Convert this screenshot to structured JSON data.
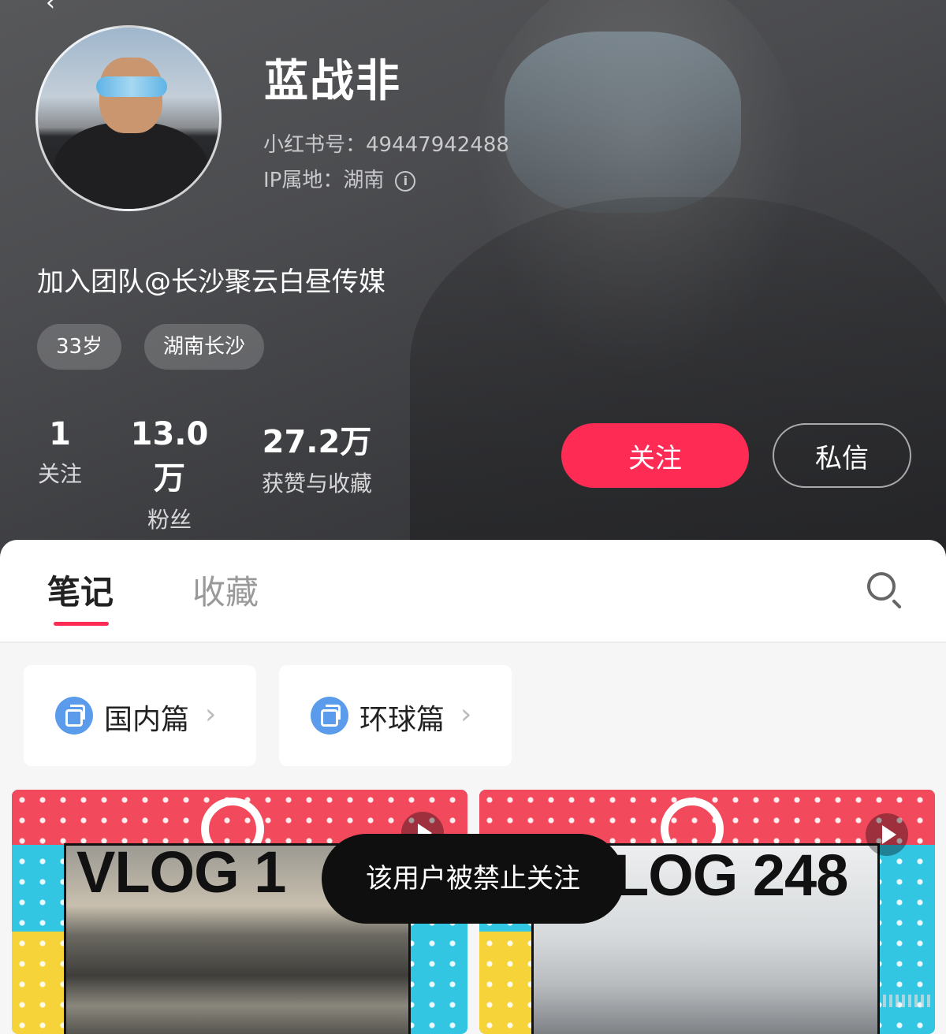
{
  "profile": {
    "name": "蓝战非",
    "account_label": "小红书号：",
    "account_id": "49447942488",
    "ip_label": "IP属地：",
    "ip_location": "湖南",
    "bio": "加入团队@长沙聚云白昼传媒",
    "tags": [
      "33岁",
      "湖南长沙"
    ]
  },
  "stats": [
    {
      "value": "1",
      "label": "关注"
    },
    {
      "value": "13.0万",
      "label": "粉丝"
    },
    {
      "value": "27.2万",
      "label": "获赞与收藏"
    }
  ],
  "actions": {
    "follow_label": "关注",
    "message_label": "私信",
    "follow_color": "#fe2c55"
  },
  "tabs": [
    {
      "label": "笔记",
      "active": true
    },
    {
      "label": "收藏",
      "active": false
    }
  ],
  "collections": [
    {
      "label": "国内篇",
      "icon": "collection-icon"
    },
    {
      "label": "环球篇",
      "icon": "collection-icon"
    }
  ],
  "notes": [
    {
      "title": "VLOG 1",
      "has_play": true
    },
    {
      "title": "LOG 248",
      "has_play": true
    }
  ],
  "toast": "该用户被禁止关注"
}
